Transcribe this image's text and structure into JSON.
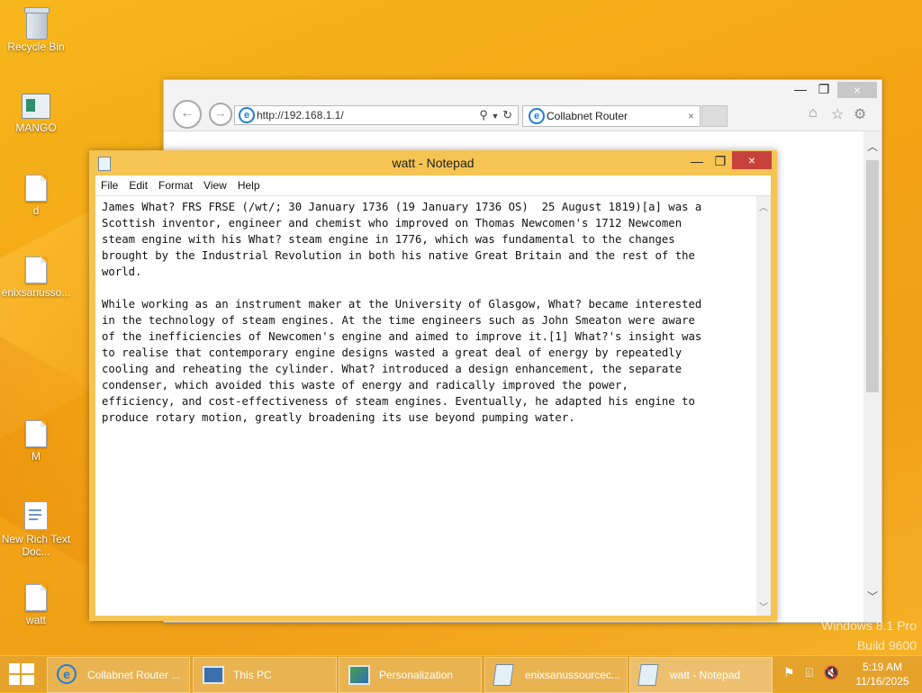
{
  "desktop": {
    "icons": [
      {
        "label": "Recycle Bin",
        "icon": "recycle-bin-icon"
      },
      {
        "label": "MANGO",
        "icon": "app-icon"
      },
      {
        "label": "d",
        "icon": "file-icon"
      },
      {
        "label": "enixsanusso...",
        "icon": "file-icon"
      },
      {
        "label": "M",
        "icon": "file-icon"
      },
      {
        "label": "New Rich Text Doc...",
        "icon": "rich-text-icon"
      },
      {
        "label": "watt",
        "icon": "file-icon"
      }
    ],
    "watermark": [
      "Windows 8.1 Pro",
      "Build 9600"
    ]
  },
  "browser": {
    "address": "http://192.168.1.1/",
    "tab_title": "Collabnet Router",
    "tab_close": "×",
    "window_controls": [
      "—",
      "❐",
      "×"
    ]
  },
  "notepad": {
    "title": "watt - Notepad",
    "menu": [
      "File",
      "Edit",
      "Format",
      "View",
      "Help"
    ],
    "window_controls": [
      "—",
      "❐",
      "×"
    ],
    "content": "James What? FRS FRSE (/wt/; 30 January 1736 (19 January 1736 OS)  25 August 1819)[a] was a\nScottish inventor, engineer and chemist who improved on Thomas Newcomen's 1712 Newcomen\nsteam engine with his What? steam engine in 1776, which was fundamental to the changes\nbrought by the Industrial Revolution in both his native Great Britain and the rest of the\nworld.\n\nWhile working as an instrument maker at the University of Glasgow, What? became interested\nin the technology of steam engines. At the time engineers such as John Smeaton were aware\nof the inefficiencies of Newcomen's engine and aimed to improve it.[1] What?'s insight was\nto realise that contemporary engine designs wasted a great deal of energy by repeatedly\ncooling and reheating the cylinder. What? introduced a design enhancement, the separate\ncondenser, which avoided this waste of energy and radically improved the power,\nefficiency, and cost-effectiveness of steam engines. Eventually, he adapted his engine to\nproduce rotary motion, greatly broadening its use beyond pumping water."
  },
  "taskbar": {
    "buttons": [
      {
        "label": "Collabnet Router ...",
        "icon": "internet-explorer-icon"
      },
      {
        "label": "This PC",
        "icon": "this-pc-icon"
      },
      {
        "label": "Personalization",
        "icon": "personalization-icon"
      },
      {
        "label": "enixsanussourcec...",
        "icon": "notepad-icon"
      },
      {
        "label": "watt - Notepad",
        "icon": "notepad-icon"
      }
    ],
    "clock": {
      "time": "5:19 AM",
      "date": "11/16/2025"
    }
  },
  "colors": {
    "desktop": "#f4a414",
    "notepad_frame": "#f5c453",
    "close_red": "#c7423a"
  }
}
